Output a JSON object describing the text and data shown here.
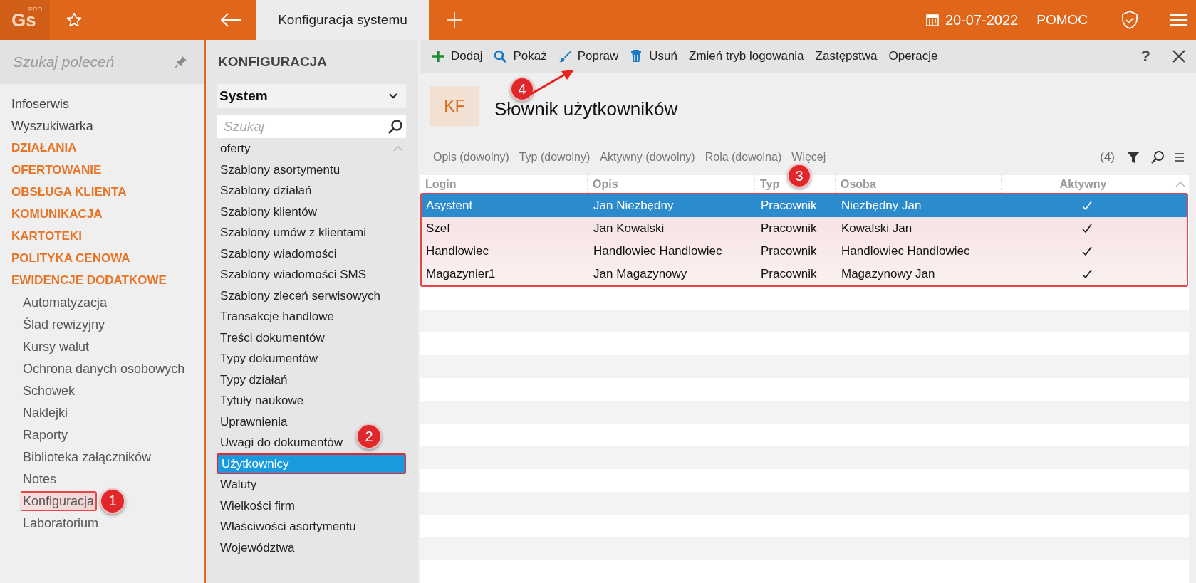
{
  "top_bar": {
    "logo": "Gs",
    "logo_mark": "PRO",
    "tab": "Konfiguracja systemu",
    "date": "20-07-2022",
    "help": "POMOC"
  },
  "sidebar": {
    "search_placeholder": "Szukaj poleceń",
    "items": [
      {
        "label": "Infoserwis",
        "kind": "link",
        "selected": false
      },
      {
        "label": "Wyszukiwarka",
        "kind": "link",
        "selected": false
      },
      {
        "label": "DZIAŁANIA",
        "kind": "section",
        "selected": false
      },
      {
        "label": "OFERTOWANIE",
        "kind": "section",
        "selected": false
      },
      {
        "label": "OBSŁUGA KLIENTA",
        "kind": "section",
        "selected": false
      },
      {
        "label": "KOMUNIKACJA",
        "kind": "section",
        "selected": false
      },
      {
        "label": "KARTOTEKI",
        "kind": "section",
        "selected": false
      },
      {
        "label": "POLITYKA CENOWA",
        "kind": "section",
        "selected": false
      },
      {
        "label": "EWIDENCJE DODATKOWE",
        "kind": "section",
        "selected": false,
        "children": [
          {
            "label": "Automatyzacja",
            "selected": false
          },
          {
            "label": "Ślad rewizyjny",
            "selected": false
          },
          {
            "label": "Kursy walut",
            "selected": false
          },
          {
            "label": "Ochrona danych osobowych",
            "selected": false
          },
          {
            "label": "Schowek",
            "selected": false
          },
          {
            "label": "Naklejki",
            "selected": false
          },
          {
            "label": "Raporty",
            "selected": false
          },
          {
            "label": "Biblioteka załączników",
            "selected": false
          },
          {
            "label": "Notes",
            "selected": false
          },
          {
            "label": "Konfiguracja",
            "selected": true
          },
          {
            "label": "Laboratorium",
            "selected": false
          }
        ]
      }
    ]
  },
  "config_panel": {
    "title": "KONFIGURACJA",
    "category": "System",
    "search_placeholder": "Szukaj",
    "items": [
      {
        "label": "oferty",
        "selected": false
      },
      {
        "label": "Szablony asortymentu",
        "selected": false
      },
      {
        "label": "Szablony działań",
        "selected": false
      },
      {
        "label": "Szablony klientów",
        "selected": false
      },
      {
        "label": "Szablony umów z klientami",
        "selected": false
      },
      {
        "label": "Szablony wiadomości",
        "selected": false
      },
      {
        "label": "Szablony wiadomości SMS",
        "selected": false
      },
      {
        "label": "Szablony zleceń serwisowych",
        "selected": false
      },
      {
        "label": "Transakcje handlowe",
        "selected": false
      },
      {
        "label": "Treści dokumentów",
        "selected": false
      },
      {
        "label": "Typy dokumentów",
        "selected": false
      },
      {
        "label": "Typy działań",
        "selected": false
      },
      {
        "label": "Tytuły naukowe",
        "selected": false
      },
      {
        "label": "Uprawnienia",
        "selected": false
      },
      {
        "label": "Uwagi do dokumentów",
        "selected": false
      },
      {
        "label": "Użytkownicy",
        "selected": true
      },
      {
        "label": "Waluty",
        "selected": false
      },
      {
        "label": "Wielkości firm",
        "selected": false
      },
      {
        "label": "Właściwości asortymentu",
        "selected": false
      },
      {
        "label": "Województwa",
        "selected": false
      }
    ]
  },
  "toolbar": {
    "actions": [
      {
        "label": "Dodaj",
        "kind": "add"
      },
      {
        "label": "Pokaż",
        "kind": "search"
      },
      {
        "label": "Popraw",
        "kind": "brush"
      },
      {
        "label": "Usuń",
        "kind": "trash"
      },
      {
        "label": "Zmień tryb logowania",
        "kind": "text"
      },
      {
        "label": "Zastępstwa",
        "kind": "text"
      },
      {
        "label": "Operacje",
        "kind": "text"
      }
    ],
    "help": "?"
  },
  "page": {
    "badge": "KF",
    "title": "Słownik użytkowników"
  },
  "filters": {
    "items": [
      "Opis (dowolny)",
      "Typ (dowolny)",
      "Aktywny (dowolny)",
      "Rola (dowolna)",
      "Więcej"
    ],
    "count": "(4)"
  },
  "table": {
    "columns": [
      "Login",
      "Opis",
      "Typ",
      "Osoba",
      "Aktywny"
    ],
    "rows": [
      {
        "cells": [
          "Asystent",
          "Jan Niezbędny",
          "Pracownik",
          "Niezbędny Jan"
        ],
        "active": true,
        "selected": true
      },
      {
        "cells": [
          "Szef",
          "Jan Kowalski",
          "Pracownik",
          "Kowalski Jan"
        ],
        "active": true,
        "selected": false
      },
      {
        "cells": [
          "Handlowiec",
          "Handlowiec Handlowiec",
          "Pracownik",
          "Handlowiec Handlowiec"
        ],
        "active": true,
        "selected": false
      },
      {
        "cells": [
          "Magazynier1",
          "Jan Magazynowy",
          "Pracownik",
          "Magazynowy Jan"
        ],
        "active": true,
        "selected": false
      }
    ]
  },
  "annotations": [
    {
      "label": "1"
    },
    {
      "label": "2"
    },
    {
      "label": "3"
    },
    {
      "label": "4"
    }
  ]
}
